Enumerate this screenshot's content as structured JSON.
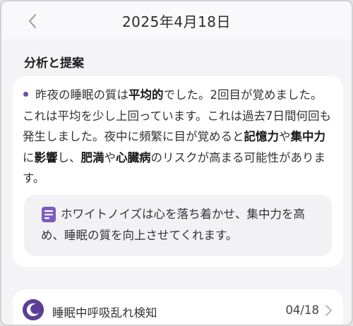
{
  "header": {
    "title": "2025年4月18日",
    "back_icon": "chevron-left-icon"
  },
  "section": {
    "title": "分析と提案"
  },
  "analysis": {
    "segments": [
      {
        "text": "昨夜の睡眠の質は",
        "bold": false
      },
      {
        "text": "平均的",
        "bold": true
      },
      {
        "text": "でした。2回目が覚めました。これは平均を少し上回っています。これは過去7日間何回も発生しました。夜中に頻繁に目が覚めると",
        "bold": false
      },
      {
        "text": "記憶力",
        "bold": true
      },
      {
        "text": "や",
        "bold": false
      },
      {
        "text": "集中力",
        "bold": true
      },
      {
        "text": "に",
        "bold": false
      },
      {
        "text": "影響",
        "bold": true
      },
      {
        "text": "し、",
        "bold": false
      },
      {
        "text": "肥満",
        "bold": true
      },
      {
        "text": "や",
        "bold": false
      },
      {
        "text": "心臓病",
        "bold": true
      },
      {
        "text": "のリスクが高まる可能性があります。",
        "bold": false
      }
    ]
  },
  "suggestion": {
    "icon": "note-icon",
    "text": "ホワイトノイズは心を落ち着かせ、集中力を高め、睡眠の質を向上させてくれます。"
  },
  "event": {
    "icon": "moon-icon",
    "title": "睡眠中呼吸乱れ検知",
    "date": "04/18",
    "chevron_icon": "chevron-right-icon"
  },
  "colors": {
    "accent": "#6b4fa8",
    "background": "#f4f4f6",
    "card": "#ffffff"
  }
}
